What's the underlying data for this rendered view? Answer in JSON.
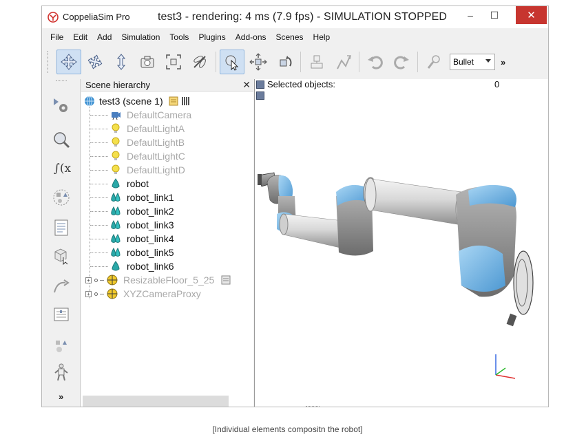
{
  "titlebar": {
    "app_name": "CoppeliaSim Pro",
    "title": "test3 - rendering: 4 ms (7.9 fps) - SIMULATION STOPPED",
    "minimize": "–",
    "maximize": "☐",
    "close": "✕"
  },
  "menu": [
    "File",
    "Edit",
    "Add",
    "Simulation",
    "Tools",
    "Plugins",
    "Add-ons",
    "Scenes",
    "Help"
  ],
  "toolbar": {
    "engine": "Bullet",
    "more": "»"
  },
  "hierarchy": {
    "title": "Scene hierarchy",
    "close": "✕",
    "root": "test3 (scene 1)",
    "items": [
      {
        "label": "DefaultCamera",
        "icon": "camera-icon"
      },
      {
        "label": "DefaultLightA",
        "icon": "light-icon"
      },
      {
        "label": "DefaultLightB",
        "icon": "light-icon"
      },
      {
        "label": "DefaultLightC",
        "icon": "light-icon"
      },
      {
        "label": "DefaultLightD",
        "icon": "light-icon"
      },
      {
        "label": "robot",
        "icon": "shape-icon"
      },
      {
        "label": "robot_link1",
        "icon": "shape-multi-icon"
      },
      {
        "label": "robot_link2",
        "icon": "shape-multi-icon"
      },
      {
        "label": "robot_link3",
        "icon": "shape-multi-icon"
      },
      {
        "label": "robot_link4",
        "icon": "shape-multi-icon"
      },
      {
        "label": "robot_link5",
        "icon": "shape-multi-icon"
      },
      {
        "label": "robot_link6",
        "icon": "shape-icon"
      },
      {
        "label": "ResizableFloor_5_25",
        "icon": "dummy-icon"
      },
      {
        "label": "XYZCameraProxy",
        "icon": "dummy-icon"
      }
    ]
  },
  "viewport": {
    "selected_label": "Selected objects:",
    "selected_count": "0"
  },
  "caption": "[Individual elements compositn the robot]",
  "colors": {
    "close_button": "#c7352f",
    "robot_grey": "#9b9b9b",
    "robot_joint_blue": "#6fb3e6",
    "hidden_text": "#a8a8a8"
  }
}
